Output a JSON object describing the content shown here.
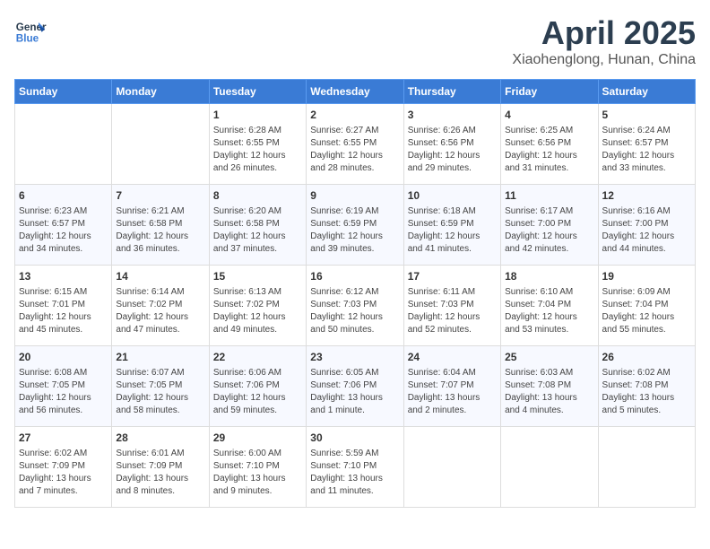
{
  "header": {
    "logo_line1": "General",
    "logo_line2": "Blue",
    "month_title": "April 2025",
    "location": "Xiaohenglong, Hunan, China"
  },
  "weekdays": [
    "Sunday",
    "Monday",
    "Tuesday",
    "Wednesday",
    "Thursday",
    "Friday",
    "Saturday"
  ],
  "weeks": [
    [
      {
        "day": "",
        "info": ""
      },
      {
        "day": "",
        "info": ""
      },
      {
        "day": "1",
        "info": "Sunrise: 6:28 AM\nSunset: 6:55 PM\nDaylight: 12 hours\nand 26 minutes."
      },
      {
        "day": "2",
        "info": "Sunrise: 6:27 AM\nSunset: 6:55 PM\nDaylight: 12 hours\nand 28 minutes."
      },
      {
        "day": "3",
        "info": "Sunrise: 6:26 AM\nSunset: 6:56 PM\nDaylight: 12 hours\nand 29 minutes."
      },
      {
        "day": "4",
        "info": "Sunrise: 6:25 AM\nSunset: 6:56 PM\nDaylight: 12 hours\nand 31 minutes."
      },
      {
        "day": "5",
        "info": "Sunrise: 6:24 AM\nSunset: 6:57 PM\nDaylight: 12 hours\nand 33 minutes."
      }
    ],
    [
      {
        "day": "6",
        "info": "Sunrise: 6:23 AM\nSunset: 6:57 PM\nDaylight: 12 hours\nand 34 minutes."
      },
      {
        "day": "7",
        "info": "Sunrise: 6:21 AM\nSunset: 6:58 PM\nDaylight: 12 hours\nand 36 minutes."
      },
      {
        "day": "8",
        "info": "Sunrise: 6:20 AM\nSunset: 6:58 PM\nDaylight: 12 hours\nand 37 minutes."
      },
      {
        "day": "9",
        "info": "Sunrise: 6:19 AM\nSunset: 6:59 PM\nDaylight: 12 hours\nand 39 minutes."
      },
      {
        "day": "10",
        "info": "Sunrise: 6:18 AM\nSunset: 6:59 PM\nDaylight: 12 hours\nand 41 minutes."
      },
      {
        "day": "11",
        "info": "Sunrise: 6:17 AM\nSunset: 7:00 PM\nDaylight: 12 hours\nand 42 minutes."
      },
      {
        "day": "12",
        "info": "Sunrise: 6:16 AM\nSunset: 7:00 PM\nDaylight: 12 hours\nand 44 minutes."
      }
    ],
    [
      {
        "day": "13",
        "info": "Sunrise: 6:15 AM\nSunset: 7:01 PM\nDaylight: 12 hours\nand 45 minutes."
      },
      {
        "day": "14",
        "info": "Sunrise: 6:14 AM\nSunset: 7:02 PM\nDaylight: 12 hours\nand 47 minutes."
      },
      {
        "day": "15",
        "info": "Sunrise: 6:13 AM\nSunset: 7:02 PM\nDaylight: 12 hours\nand 49 minutes."
      },
      {
        "day": "16",
        "info": "Sunrise: 6:12 AM\nSunset: 7:03 PM\nDaylight: 12 hours\nand 50 minutes."
      },
      {
        "day": "17",
        "info": "Sunrise: 6:11 AM\nSunset: 7:03 PM\nDaylight: 12 hours\nand 52 minutes."
      },
      {
        "day": "18",
        "info": "Sunrise: 6:10 AM\nSunset: 7:04 PM\nDaylight: 12 hours\nand 53 minutes."
      },
      {
        "day": "19",
        "info": "Sunrise: 6:09 AM\nSunset: 7:04 PM\nDaylight: 12 hours\nand 55 minutes."
      }
    ],
    [
      {
        "day": "20",
        "info": "Sunrise: 6:08 AM\nSunset: 7:05 PM\nDaylight: 12 hours\nand 56 minutes."
      },
      {
        "day": "21",
        "info": "Sunrise: 6:07 AM\nSunset: 7:05 PM\nDaylight: 12 hours\nand 58 minutes."
      },
      {
        "day": "22",
        "info": "Sunrise: 6:06 AM\nSunset: 7:06 PM\nDaylight: 12 hours\nand 59 minutes."
      },
      {
        "day": "23",
        "info": "Sunrise: 6:05 AM\nSunset: 7:06 PM\nDaylight: 13 hours\nand 1 minute."
      },
      {
        "day": "24",
        "info": "Sunrise: 6:04 AM\nSunset: 7:07 PM\nDaylight: 13 hours\nand 2 minutes."
      },
      {
        "day": "25",
        "info": "Sunrise: 6:03 AM\nSunset: 7:08 PM\nDaylight: 13 hours\nand 4 minutes."
      },
      {
        "day": "26",
        "info": "Sunrise: 6:02 AM\nSunset: 7:08 PM\nDaylight: 13 hours\nand 5 minutes."
      }
    ],
    [
      {
        "day": "27",
        "info": "Sunrise: 6:02 AM\nSunset: 7:09 PM\nDaylight: 13 hours\nand 7 minutes."
      },
      {
        "day": "28",
        "info": "Sunrise: 6:01 AM\nSunset: 7:09 PM\nDaylight: 13 hours\nand 8 minutes."
      },
      {
        "day": "29",
        "info": "Sunrise: 6:00 AM\nSunset: 7:10 PM\nDaylight: 13 hours\nand 9 minutes."
      },
      {
        "day": "30",
        "info": "Sunrise: 5:59 AM\nSunset: 7:10 PM\nDaylight: 13 hours\nand 11 minutes."
      },
      {
        "day": "",
        "info": ""
      },
      {
        "day": "",
        "info": ""
      },
      {
        "day": "",
        "info": ""
      }
    ]
  ]
}
